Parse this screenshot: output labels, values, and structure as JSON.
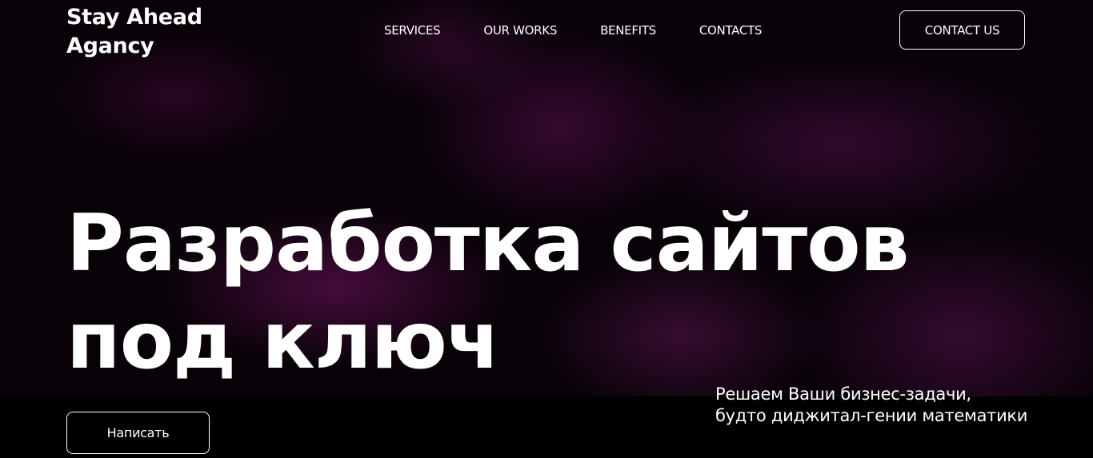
{
  "brand": {
    "line1": "Stay Ahead",
    "line2": "Agancy"
  },
  "nav": {
    "items": [
      "SERVICES",
      "OUR WORKS",
      "BENEFITS",
      "CONTACTS"
    ]
  },
  "header": {
    "contact_button": "CONTACT US"
  },
  "hero": {
    "title_line1": "Разработка сайтов",
    "title_line2": "под ключ",
    "cta_button": "Написать",
    "tagline_line1": "Решаем Ваши бизнес-задачи,",
    "tagline_line2": "будто диджитал-гении математики"
  },
  "colors": {
    "background": "#000000",
    "smoke_accent": "#6e1460",
    "text": "#ffffff"
  }
}
